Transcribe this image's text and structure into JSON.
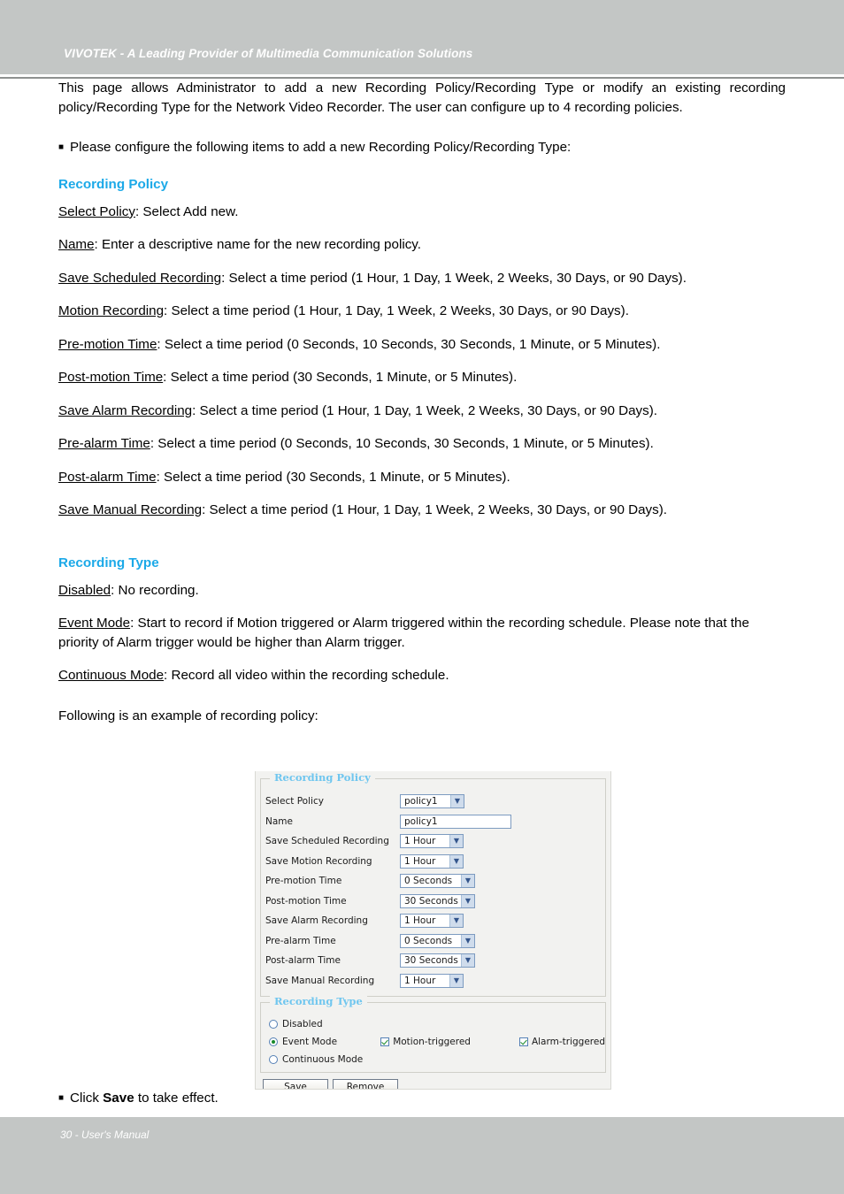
{
  "header": {
    "title": "VIVOTEK - A Leading Provider of Multimedia Communication Solutions"
  },
  "intro": "This page allows Administrator to add a new Recording Policy/Recording Type or modify an existing recording policy/Recording Type for the Network Video Recorder. The user can configure up to 4 recording policies.",
  "bullet_intro": "Please configure the following items to add a new Recording Policy/Recording Type:",
  "bullet_glyph": "■",
  "sections": {
    "policy": {
      "heading": "Recording Policy",
      "items": [
        {
          "term": "Select Policy",
          "desc": ": Select Add new."
        },
        {
          "term": "Name",
          "desc": ": Enter a descriptive name for the new recording policy."
        },
        {
          "term": "Save Scheduled Recording",
          "desc": ": Select a time period (1 Hour, 1 Day, 1 Week, 2 Weeks, 30 Days, or 90 Days)."
        },
        {
          "term": "Motion Recording",
          "desc": ": Select a time period (1 Hour, 1 Day, 1 Week, 2 Weeks, 30 Days, or 90 Days)."
        },
        {
          "term": "Pre-motion Time",
          "desc": ": Select a time period (0 Seconds, 10 Seconds, 30 Seconds, 1 Minute, or 5 Minutes)."
        },
        {
          "term": "Post-motion Time",
          "desc": ": Select a time period (30 Seconds, 1 Minute, or 5 Minutes)."
        },
        {
          "term": "Save Alarm Recording",
          "desc": ": Select a time period (1 Hour, 1 Day, 1 Week, 2 Weeks, 30 Days, or 90 Days)."
        },
        {
          "term": "Pre-alarm Time",
          "desc": ": Select a time period (0 Seconds, 10 Seconds, 30 Seconds, 1 Minute, or 5 Minutes)."
        },
        {
          "term": "Post-alarm Time",
          "desc": ": Select a time period (30 Seconds, 1 Minute, or 5 Minutes)."
        },
        {
          "term": "Save Manual Recording",
          "desc": ": Select a time period (1 Hour, 1 Day, 1 Week, 2 Weeks, 30 Days, or 90 Days)."
        }
      ]
    },
    "type": {
      "heading": "Recording Type",
      "items": [
        {
          "term": "Disabled",
          "desc": ": No recording."
        },
        {
          "term": "Event Mode",
          "desc": ": Start to record if Motion triggered or Alarm triggered within the recording schedule. Please note that the priority of Alarm trigger would be higher than Alarm trigger."
        },
        {
          "term": "Continuous Mode",
          "desc": ": Record all video within the recording schedule."
        }
      ]
    }
  },
  "following_caption": "Following is an example of recording policy:",
  "screenshot": {
    "policy_panel": {
      "legend": "Recording Policy",
      "rows": [
        {
          "label": "Select Policy",
          "control": "select",
          "value": "policy1"
        },
        {
          "label": "Name",
          "control": "text",
          "value": "policy1"
        },
        {
          "label": "Save Scheduled Recording",
          "control": "select",
          "value": "1 Hour"
        },
        {
          "label": "Save Motion Recording",
          "control": "select",
          "value": "1 Hour"
        },
        {
          "label": "Pre-motion Time",
          "control": "select",
          "value": "0 Seconds"
        },
        {
          "label": "Post-motion Time",
          "control": "select",
          "value": "30 Seconds"
        },
        {
          "label": "Save Alarm Recording",
          "control": "select",
          "value": "1 Hour"
        },
        {
          "label": "Pre-alarm Time",
          "control": "select",
          "value": "0 Seconds"
        },
        {
          "label": "Post-alarm Time",
          "control": "select",
          "value": "30 Seconds"
        },
        {
          "label": "Save Manual Recording",
          "control": "select",
          "value": "1 Hour"
        }
      ]
    },
    "type_panel": {
      "legend": "Recording Type",
      "radios": [
        {
          "label": "Disabled",
          "selected": false
        },
        {
          "label": "Event Mode",
          "selected": true
        },
        {
          "label": "Continuous Mode",
          "selected": false
        }
      ],
      "checkboxes": [
        {
          "label": "Motion-triggered",
          "checked": true
        },
        {
          "label": "Alarm-triggered",
          "checked": true
        }
      ]
    },
    "buttons": {
      "save": "Save",
      "remove": "Remove"
    }
  },
  "click_save": {
    "prefix": "Click ",
    "strong": "Save",
    "suffix": " to take effect."
  },
  "footer": {
    "text": "30 - User's Manual"
  },
  "colors": {
    "band": "#c3c6c5",
    "section_heading": "#1ba9e8",
    "legend": "#6fc6ef",
    "panel_bg": "#f2f2f0",
    "control_border": "#7d9bc0",
    "check_green": "#1c8a2b"
  }
}
